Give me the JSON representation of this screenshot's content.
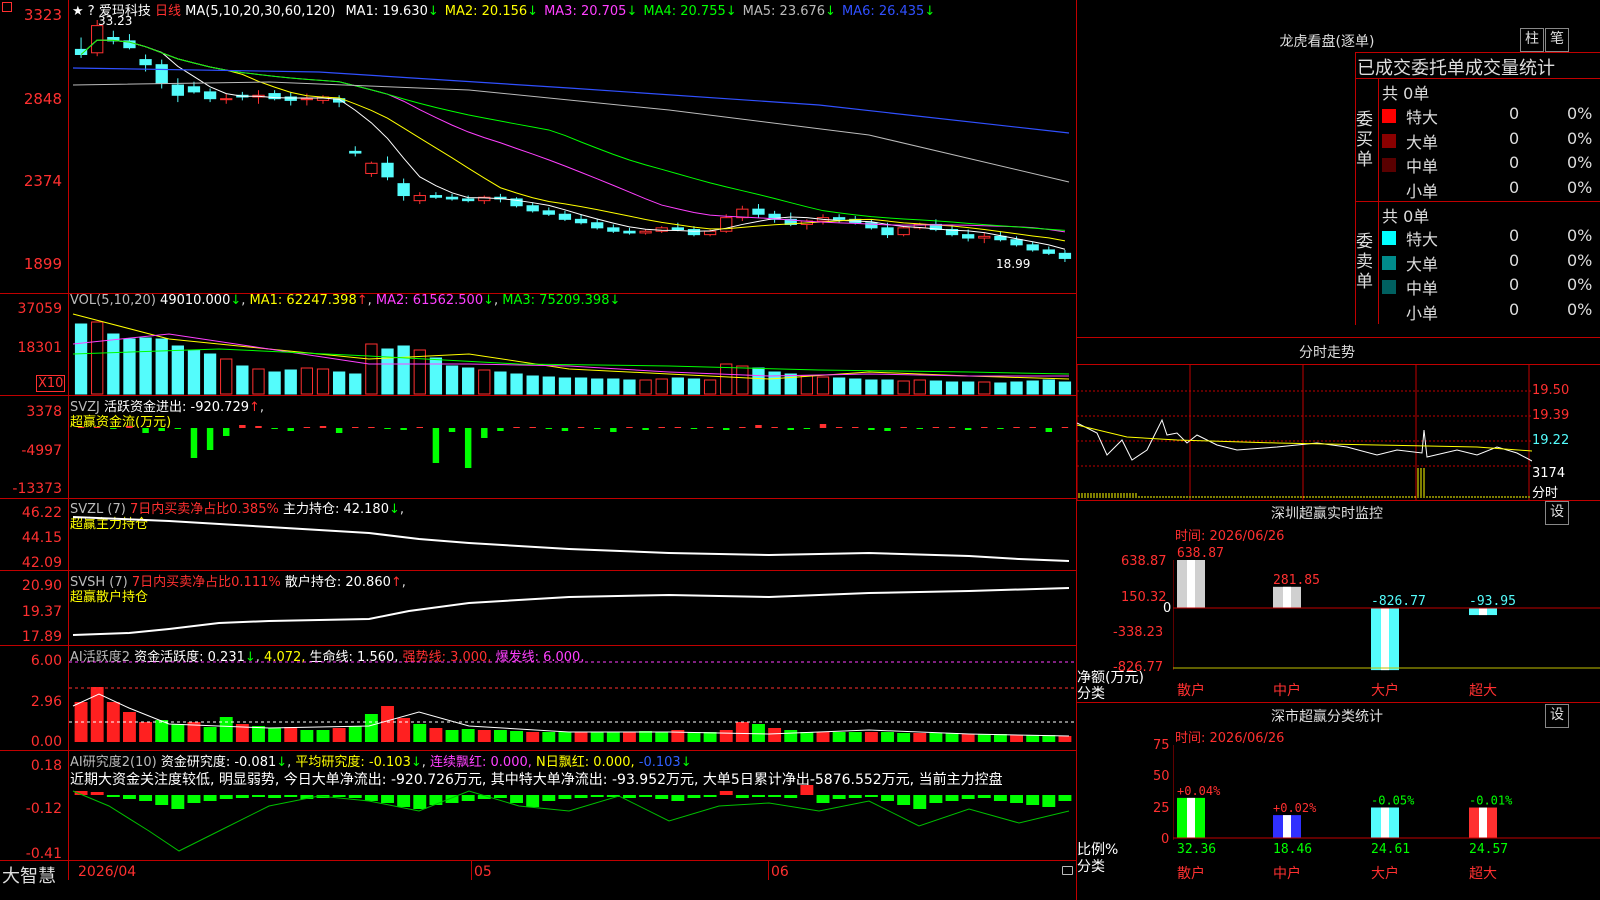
{
  "stock": {
    "name": "爱玛科技",
    "period": "日线",
    "hi_mark": "33.23",
    "lo_mark": "18.99"
  },
  "ma_line": {
    "label": "MA(5,10,20,30,60,120)",
    "items": [
      {
        "text": "MA1: 19.630",
        "arrow": "↓",
        "color": "#ffffff"
      },
      {
        "text": "MA2: 20.156",
        "arrow": "↓",
        "color": "#ffff00"
      },
      {
        "text": "MA3: 20.705",
        "arrow": "↓",
        "color": "#ff40ff"
      },
      {
        "text": "MA4: 20.755",
        "arrow": "↓",
        "color": "#00ff00"
      },
      {
        "text": "MA5: 23.676",
        "arrow": "↓",
        "color": "#bbbbbb"
      },
      {
        "text": "MA6: 26.435",
        "arrow": "↓",
        "color": "#3050ff"
      }
    ]
  },
  "price_axis": [
    "3323",
    "2848",
    "2374",
    "1899"
  ],
  "vol": {
    "label": "VOL(5,10,20)",
    "value": "49010.000",
    "ma1": "MA1: 62247.398",
    "ma2": "MA2: 61562.500",
    "ma3": "MA3: 75209.398",
    "axis": [
      "37059",
      "18301"
    ],
    "unit": "X10"
  },
  "svzj": {
    "label": "SVZJ",
    "line": "活跃资金进出: -920.729",
    "sub": "超赢资金流(万元)",
    "axis": [
      "3378",
      "-4997",
      "-13373"
    ]
  },
  "svzl": {
    "label": "SVZL (7)",
    "ratio": "7日内买卖净占比0.385%",
    "hold": "主力持仓: 42.180",
    "sub": "超赢主力持仓",
    "axis": [
      "46.22",
      "44.15",
      "42.09"
    ]
  },
  "svsh": {
    "label": "SVSH (7)",
    "ratio": "7日内买卖净占比0.111%",
    "hold": "散户持仓: 20.860",
    "sub": "超赢散户持仓",
    "axis": [
      "20.90",
      "19.37",
      "17.89"
    ]
  },
  "ai_active": {
    "label": "AI活跃度2",
    "a": "资金活跃度: 0.231",
    "b": "4.072,",
    "c": "生命线: 1.560,",
    "d": "强势线: 3.000,",
    "e": "爆发线: 6.000,",
    "axis": [
      "6.00",
      "2.96",
      "0.00"
    ]
  },
  "ai_research": {
    "label": "AI研究度2(10)",
    "a": "资金研究度: -0.081",
    "b": "平均研究度: -0.103",
    "c": "连续飘红: 0.000,",
    "d": "N日飘红: 0.000,",
    "e": "-0.103",
    "note": "近期大资金关注度较低, 明显弱势, 今日大单净流出: -920.726万元, 其中特大单净流出: -93.952万元, 大单5日累计净出-5876.552万元, 当前主力控盘",
    "axis": [
      "0.18",
      "-0.12",
      "-0.41"
    ]
  },
  "x_axis": [
    "2026/04",
    "05",
    "06"
  ],
  "brand": "大智慧",
  "dragon": {
    "title": "龙虎看盘(逐单)",
    "btn1": "柱",
    "btn2": "笔",
    "header": "已成交委托单成交量统计",
    "buy": {
      "side": "委买单",
      "total": "共 0单",
      "rows": [
        {
          "label": "特大",
          "n": "0",
          "pct": "0%",
          "color": "#ff0000"
        },
        {
          "label": "大单",
          "n": "0",
          "pct": "0%",
          "color": "#8b0000"
        },
        {
          "label": "中单",
          "n": "0",
          "pct": "0%",
          "color": "#5a0000"
        },
        {
          "label": "小单",
          "n": "0",
          "pct": "0%",
          "color": "#000000"
        }
      ]
    },
    "sell": {
      "side": "委卖单",
      "total": "共 0单",
      "rows": [
        {
          "label": "特大",
          "n": "0",
          "pct": "0%",
          "color": "#00ffff"
        },
        {
          "label": "大单",
          "n": "0",
          "pct": "0%",
          "color": "#008b8b"
        },
        {
          "label": "中单",
          "n": "0",
          "pct": "0%",
          "color": "#006060"
        },
        {
          "label": "小单",
          "n": "0",
          "pct": "0%",
          "color": "#000000"
        }
      ]
    }
  },
  "intraday": {
    "title": "分时走势",
    "axis": [
      "19.50",
      "19.39",
      "19.22"
    ],
    "vol_label": "3174",
    "time_label": "分时"
  },
  "monitor": {
    "title": "深圳超赢实时监控",
    "btn": "设",
    "date": "时间: 2026/06/26",
    "axis": [
      "638.87",
      "150.32",
      "0",
      "-338.23",
      "-826.77"
    ],
    "left_label1": "净额(万元)",
    "left_label2": "分类",
    "cats": [
      "散户",
      "中户",
      "大户",
      "超大"
    ],
    "values": [
      "638.87",
      "281.85",
      "-826.77",
      "-93.95"
    ]
  },
  "classify": {
    "title": "深市超赢分类统计",
    "btn": "设",
    "date": "时间: 2026/06/26",
    "axis": [
      "75",
      "50",
      "25",
      "0"
    ],
    "left_label1": "比例%",
    "left_label2": "分类",
    "cats": [
      "散户",
      "中户",
      "大户",
      "超大"
    ],
    "changes": [
      "+0.04%",
      "+0.02%",
      "-0.05%",
      "-0.01%"
    ],
    "values": [
      "32.36",
      "18.46",
      "24.61",
      "24.57"
    ]
  },
  "chart_data": {
    "type": "candlestick",
    "ylim": [
      1899,
      3323
    ],
    "candles": [
      [
        31.5,
        32.2,
        31.0,
        31.2
      ],
      [
        31.3,
        33.23,
        31.1,
        32.9
      ],
      [
        32.2,
        32.6,
        31.8,
        32.0
      ],
      [
        32.0,
        32.4,
        31.5,
        31.6
      ],
      [
        30.9,
        31.2,
        30.2,
        30.6
      ],
      [
        30.6,
        30.9,
        29.2,
        29.5
      ],
      [
        29.4,
        29.8,
        28.4,
        28.8
      ],
      [
        29.3,
        29.6,
        28.9,
        29.0
      ],
      [
        29.0,
        29.2,
        28.4,
        28.6
      ],
      [
        28.6,
        28.9,
        28.3,
        28.6
      ],
      [
        28.8,
        29.0,
        28.5,
        28.7
      ],
      [
        28.7,
        29.1,
        28.3,
        28.8
      ],
      [
        28.9,
        29.1,
        28.5,
        28.6
      ],
      [
        28.7,
        29.0,
        28.2,
        28.5
      ],
      [
        28.6,
        28.9,
        28.2,
        28.6
      ],
      [
        28.5,
        28.8,
        28.3,
        28.7
      ],
      [
        28.6,
        28.8,
        28.1,
        28.4
      ],
      [
        25.5,
        25.8,
        25.2,
        25.4
      ],
      [
        24.2,
        24.9,
        24.0,
        24.8
      ],
      [
        24.8,
        25.2,
        23.8,
        24.0
      ],
      [
        23.6,
        23.9,
        22.6,
        22.9
      ],
      [
        22.6,
        23.1,
        22.4,
        22.9
      ],
      [
        22.9,
        23.1,
        22.7,
        22.8
      ],
      [
        22.8,
        23.0,
        22.6,
        22.7
      ],
      [
        22.7,
        22.9,
        22.5,
        22.6
      ],
      [
        22.6,
        22.9,
        22.4,
        22.8
      ],
      [
        22.8,
        23.0,
        22.5,
        22.7
      ],
      [
        22.7,
        22.8,
        22.2,
        22.3
      ],
      [
        22.3,
        22.5,
        21.9,
        22.0
      ],
      [
        22.0,
        22.2,
        21.7,
        21.8
      ],
      [
        21.8,
        22.0,
        21.4,
        21.5
      ],
      [
        21.5,
        21.8,
        21.2,
        21.3
      ],
      [
        21.3,
        21.5,
        20.9,
        21.0
      ],
      [
        21.0,
        21.2,
        20.7,
        20.8
      ],
      [
        20.8,
        21.0,
        20.6,
        20.7
      ],
      [
        20.7,
        20.9,
        20.6,
        20.8
      ],
      [
        20.8,
        21.1,
        20.7,
        21.0
      ],
      [
        21.0,
        21.3,
        20.8,
        20.9
      ],
      [
        20.9,
        21.1,
        20.5,
        20.6
      ],
      [
        20.6,
        20.9,
        20.5,
        20.8
      ],
      [
        20.8,
        21.8,
        20.7,
        21.6
      ],
      [
        21.6,
        22.3,
        21.4,
        22.1
      ],
      [
        22.1,
        22.4,
        21.6,
        21.8
      ],
      [
        21.8,
        22.0,
        21.3,
        21.5
      ],
      [
        21.5,
        21.9,
        21.1,
        21.2
      ],
      [
        21.2,
        21.5,
        20.9,
        21.4
      ],
      [
        21.4,
        21.8,
        21.2,
        21.6
      ],
      [
        21.6,
        21.8,
        21.3,
        21.5
      ],
      [
        21.5,
        21.7,
        21.2,
        21.3
      ],
      [
        21.3,
        21.5,
        20.9,
        21.0
      ],
      [
        21.0,
        21.3,
        20.4,
        20.6
      ],
      [
        20.6,
        21.1,
        20.5,
        21.0
      ],
      [
        21.0,
        21.3,
        20.9,
        21.2
      ],
      [
        21.2,
        21.5,
        20.8,
        20.9
      ],
      [
        20.9,
        21.2,
        20.5,
        20.6
      ],
      [
        20.6,
        20.9,
        20.2,
        20.4
      ],
      [
        20.4,
        20.7,
        20.1,
        20.5
      ],
      [
        20.5,
        20.8,
        20.2,
        20.3
      ],
      [
        20.3,
        20.5,
        19.9,
        20.0
      ],
      [
        20.0,
        20.2,
        19.6,
        19.7
      ],
      [
        19.7,
        19.9,
        19.4,
        19.5
      ],
      [
        19.5,
        19.7,
        18.99,
        19.2
      ]
    ]
  }
}
